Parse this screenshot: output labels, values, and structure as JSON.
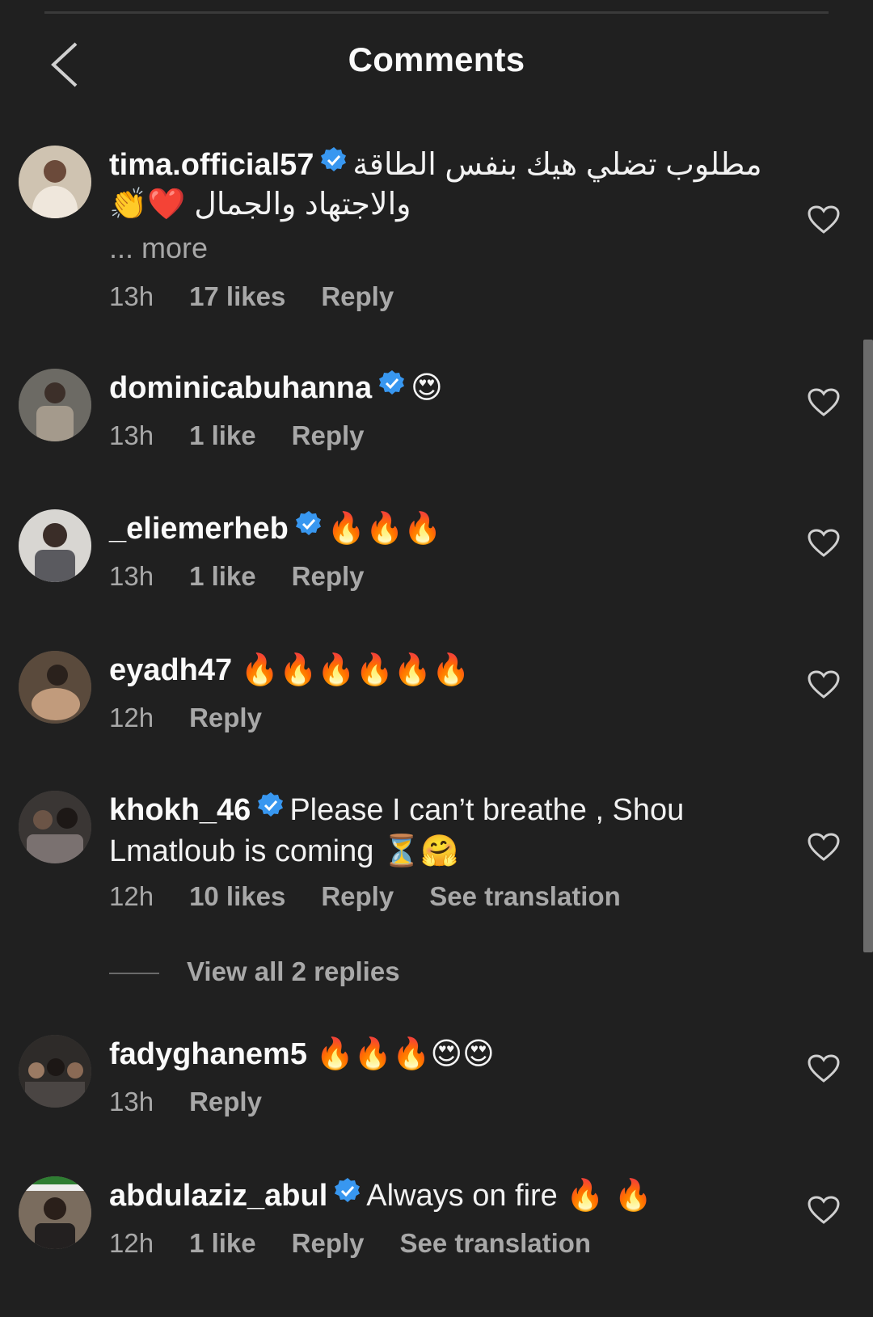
{
  "header": {
    "title": "Comments"
  },
  "comments": [
    {
      "username": "tima.official57",
      "verified": true,
      "text_line1": "مطلوب تضلي هيك بنفس الطاقة",
      "text_line2": "والاجتهاد والجمال",
      "emoji_line2": "👏❤️",
      "more": "... more",
      "time": "13h",
      "likes": "17 likes",
      "reply": "Reply"
    },
    {
      "username": "dominicabuhanna",
      "verified": true,
      "text": "😍",
      "time": "13h",
      "likes": "1 like",
      "reply": "Reply"
    },
    {
      "username": "_eliemerheb",
      "verified": true,
      "text": "🔥🔥🔥",
      "time": "13h",
      "likes": "1 like",
      "reply": "Reply"
    },
    {
      "username": "eyadh47",
      "verified": false,
      "text": "🔥🔥🔥🔥🔥🔥",
      "time": "12h",
      "reply": "Reply"
    },
    {
      "username": "khokh_46",
      "verified": true,
      "text_line1": "Please I can’t breathe , Shou",
      "text_line2": "Lmatloub is coming",
      "emoji_line2": "⏳🤗",
      "time": "12h",
      "likes": "10 likes",
      "reply": "Reply",
      "translate": "See translation",
      "view_replies": "View all 2 replies"
    },
    {
      "username": "fadyghanem5",
      "verified": false,
      "text": "🔥🔥🔥😍😍",
      "time": "13h",
      "reply": "Reply"
    },
    {
      "username": "abdulaziz_abul",
      "verified": true,
      "text": "Always on fire",
      "emoji": "🔥 🔥",
      "time": "12h",
      "likes": "1 like",
      "reply": "Reply",
      "translate": "See translation"
    }
  ],
  "colors": {
    "background": "#202020",
    "verified": "#3897f0",
    "secondary_text": "#a8a8a8"
  }
}
